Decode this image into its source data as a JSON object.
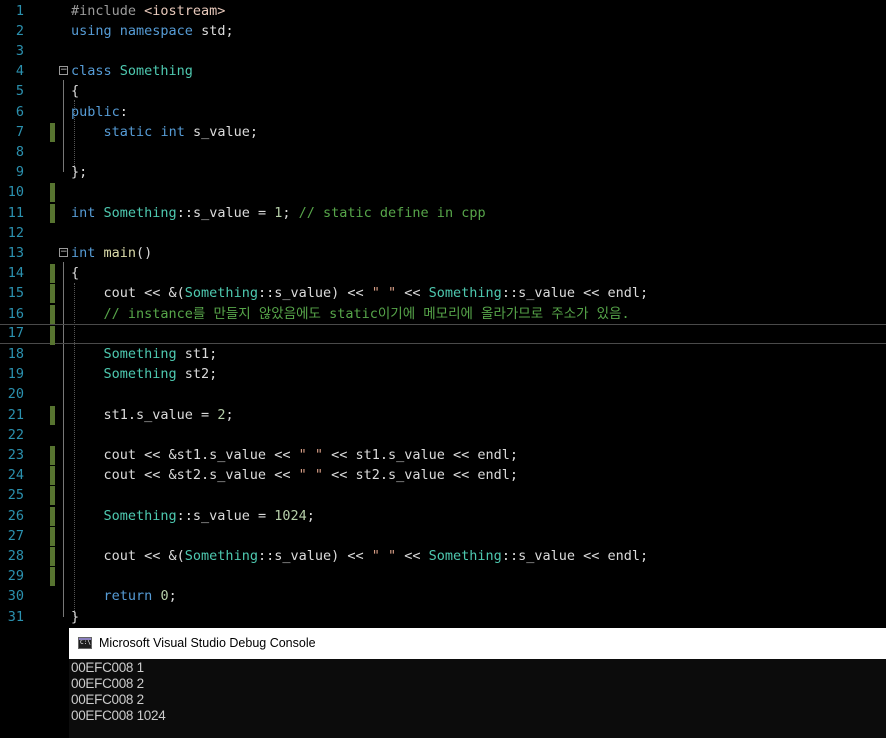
{
  "editor": {
    "lines": [
      {
        "n": "1",
        "tokens": [
          {
            "t": "#include ",
            "c": "pp"
          },
          {
            "t": "<iostream>",
            "c": "inc"
          }
        ]
      },
      {
        "n": "2",
        "tokens": [
          {
            "t": "using",
            "c": "kw"
          },
          {
            "t": " "
          },
          {
            "t": "namespace",
            "c": "kw"
          },
          {
            "t": " std;"
          }
        ]
      },
      {
        "n": "3",
        "tokens": []
      },
      {
        "n": "4",
        "fold": true,
        "tokens": [
          {
            "t": "class",
            "c": "kw"
          },
          {
            "t": " "
          },
          {
            "t": "Something",
            "c": "ty"
          }
        ]
      },
      {
        "n": "5",
        "tokens": [
          {
            "t": "{"
          }
        ]
      },
      {
        "n": "6",
        "tokens": [
          {
            "t": "public",
            "c": "kw"
          },
          {
            "t": ":"
          }
        ]
      },
      {
        "n": "7",
        "changed": true,
        "tokens": [
          {
            "t": "    "
          },
          {
            "t": "static",
            "c": "kw"
          },
          {
            "t": " "
          },
          {
            "t": "int",
            "c": "kw"
          },
          {
            "t": " s_value;"
          }
        ]
      },
      {
        "n": "8",
        "tokens": []
      },
      {
        "n": "9",
        "tokens": [
          {
            "t": "};"
          }
        ]
      },
      {
        "n": "10",
        "changed": true,
        "tokens": []
      },
      {
        "n": "11",
        "changed": true,
        "tokens": [
          {
            "t": "int",
            "c": "kw"
          },
          {
            "t": " "
          },
          {
            "t": "Something",
            "c": "ty"
          },
          {
            "t": "::s_value = "
          },
          {
            "t": "1",
            "c": "num"
          },
          {
            "t": "; "
          },
          {
            "t": "// static define in cpp",
            "c": "cm"
          }
        ]
      },
      {
        "n": "12",
        "tokens": []
      },
      {
        "n": "13",
        "fold": true,
        "tokens": [
          {
            "t": "int",
            "c": "kw"
          },
          {
            "t": " "
          },
          {
            "t": "main",
            "c": "fn"
          },
          {
            "t": "()"
          }
        ]
      },
      {
        "n": "14",
        "changed": true,
        "tokens": [
          {
            "t": "{"
          }
        ]
      },
      {
        "n": "15",
        "changed": true,
        "tokens": [
          {
            "t": "    cout << &("
          },
          {
            "t": "Something",
            "c": "ty"
          },
          {
            "t": "::s_value) << "
          },
          {
            "t": "\" \"",
            "c": "str"
          },
          {
            "t": " << "
          },
          {
            "t": "Something",
            "c": "ty"
          },
          {
            "t": "::s_value << endl;"
          }
        ]
      },
      {
        "n": "16",
        "changed": true,
        "tokens": [
          {
            "t": "    "
          },
          {
            "t": "// instance를 만들지 않았음에도 static이기에 메모리에 올라가므로 주소가 있음.",
            "c": "cm"
          }
        ]
      },
      {
        "n": "17",
        "changed": true,
        "current": true,
        "tokens": []
      },
      {
        "n": "18",
        "tokens": [
          {
            "t": "    "
          },
          {
            "t": "Something",
            "c": "ty"
          },
          {
            "t": " st1;"
          }
        ]
      },
      {
        "n": "19",
        "tokens": [
          {
            "t": "    "
          },
          {
            "t": "Something",
            "c": "ty"
          },
          {
            "t": " st2;"
          }
        ]
      },
      {
        "n": "20",
        "tokens": []
      },
      {
        "n": "21",
        "changed": true,
        "tokens": [
          {
            "t": "    st1.s_value = "
          },
          {
            "t": "2",
            "c": "num"
          },
          {
            "t": ";"
          }
        ]
      },
      {
        "n": "22",
        "tokens": []
      },
      {
        "n": "23",
        "changed": true,
        "tokens": [
          {
            "t": "    cout << &st1.s_value << "
          },
          {
            "t": "\" \"",
            "c": "str"
          },
          {
            "t": " << st1.s_value << endl;"
          }
        ]
      },
      {
        "n": "24",
        "changed": true,
        "tokens": [
          {
            "t": "    cout << &st2.s_value << "
          },
          {
            "t": "\" \"",
            "c": "str"
          },
          {
            "t": " << st2.s_value << endl;"
          }
        ]
      },
      {
        "n": "25",
        "changed": true,
        "tokens": []
      },
      {
        "n": "26",
        "changed": true,
        "tokens": [
          {
            "t": "    "
          },
          {
            "t": "Something",
            "c": "ty"
          },
          {
            "t": "::s_value = "
          },
          {
            "t": "1024",
            "c": "num"
          },
          {
            "t": ";"
          }
        ]
      },
      {
        "n": "27",
        "changed": true,
        "tokens": []
      },
      {
        "n": "28",
        "changed": true,
        "tokens": [
          {
            "t": "    cout << &("
          },
          {
            "t": "Something",
            "c": "ty"
          },
          {
            "t": "::s_value) << "
          },
          {
            "t": "\" \"",
            "c": "str"
          },
          {
            "t": " << "
          },
          {
            "t": "Something",
            "c": "ty"
          },
          {
            "t": "::s_value << endl;"
          }
        ]
      },
      {
        "n": "29",
        "changed": true,
        "tokens": []
      },
      {
        "n": "30",
        "tokens": [
          {
            "t": "    "
          },
          {
            "t": "return",
            "c": "kw"
          },
          {
            "t": " "
          },
          {
            "t": "0",
            "c": "num"
          },
          {
            "t": ";"
          }
        ]
      },
      {
        "n": "31",
        "tokens": [
          {
            "t": "}"
          }
        ]
      }
    ]
  },
  "console": {
    "icon": "console-app-icon",
    "icon_text": "C:\\",
    "title": "Microsoft Visual Studio Debug Console",
    "output": [
      "00EFC008 1",
      "00EFC008 2",
      "00EFC008 2",
      "00EFC008 1024"
    ]
  }
}
